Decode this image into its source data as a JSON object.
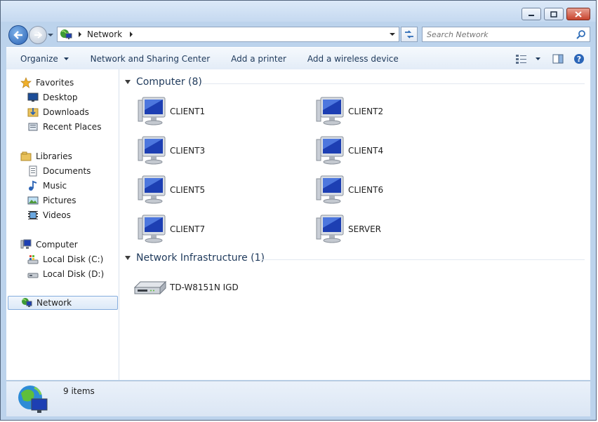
{
  "window": {
    "title": "Network"
  },
  "address": {
    "crumbs": [
      "Network"
    ]
  },
  "search": {
    "placeholder": "Search Network"
  },
  "toolbar": {
    "organize": "Organize",
    "network_sharing_center": "Network and Sharing Center",
    "add_printer": "Add a printer",
    "add_wireless_device": "Add a wireless device"
  },
  "nav": {
    "favorites": {
      "label": "Favorites",
      "items": [
        "Desktop",
        "Downloads",
        "Recent Places"
      ]
    },
    "libraries": {
      "label": "Libraries",
      "items": [
        "Documents",
        "Music",
        "Pictures",
        "Videos"
      ]
    },
    "computer": {
      "label": "Computer",
      "items": [
        "Local Disk (C:)",
        "Local Disk (D:)"
      ]
    },
    "network": {
      "label": "Network"
    }
  },
  "groups": {
    "computer": {
      "label": "Computer (8)",
      "items": [
        "CLIENT1",
        "CLIENT2",
        "CLIENT3",
        "CLIENT4",
        "CLIENT5",
        "CLIENT6",
        "CLIENT7",
        "SERVER"
      ]
    },
    "infrastructure": {
      "label": "Network Infrastructure (1)",
      "items": [
        "TD-W8151N IGD"
      ]
    }
  },
  "status": {
    "count": "9 items"
  },
  "colors": {
    "accent": "#1e395b",
    "selection": "#dce9f8",
    "chrome": "#bcd3ec"
  }
}
